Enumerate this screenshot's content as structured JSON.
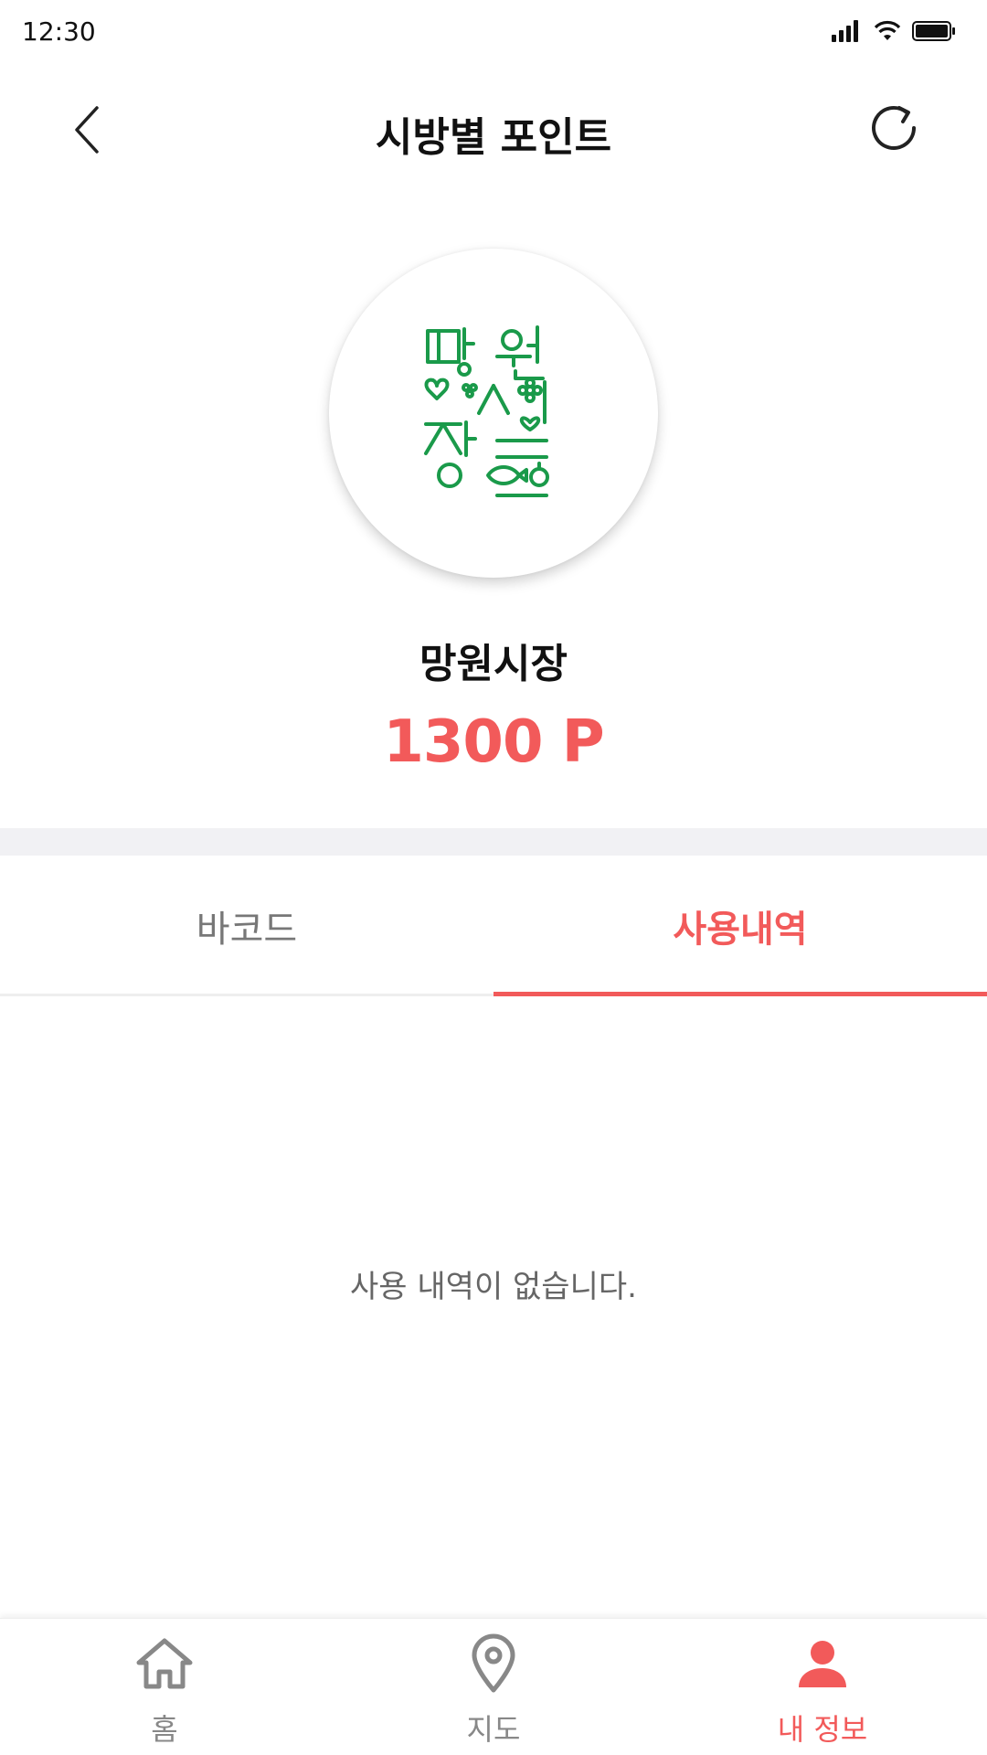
{
  "status_bar": {
    "time": "12:30"
  },
  "header": {
    "title": "시방별 포인트",
    "back_icon": "chevron-left-icon",
    "refresh_icon": "refresh-icon"
  },
  "market": {
    "name": "망원시장",
    "points": "1300 P",
    "logo_text": "망원시장",
    "logo_color": "#1a9a4a"
  },
  "tabs": [
    {
      "label": "바코드",
      "active": false
    },
    {
      "label": "사용내역",
      "active": true
    }
  ],
  "history": {
    "empty_message": "사용 내역이 없습니다."
  },
  "bottom_nav": [
    {
      "label": "홈",
      "icon": "home-icon",
      "active": false
    },
    {
      "label": "지도",
      "icon": "map-pin-icon",
      "active": false
    },
    {
      "label": "내 정보",
      "icon": "user-icon",
      "active": true
    }
  ],
  "colors": {
    "accent": "#f25a5a",
    "inactive": "#888888",
    "divider": "#f1f1f4"
  }
}
